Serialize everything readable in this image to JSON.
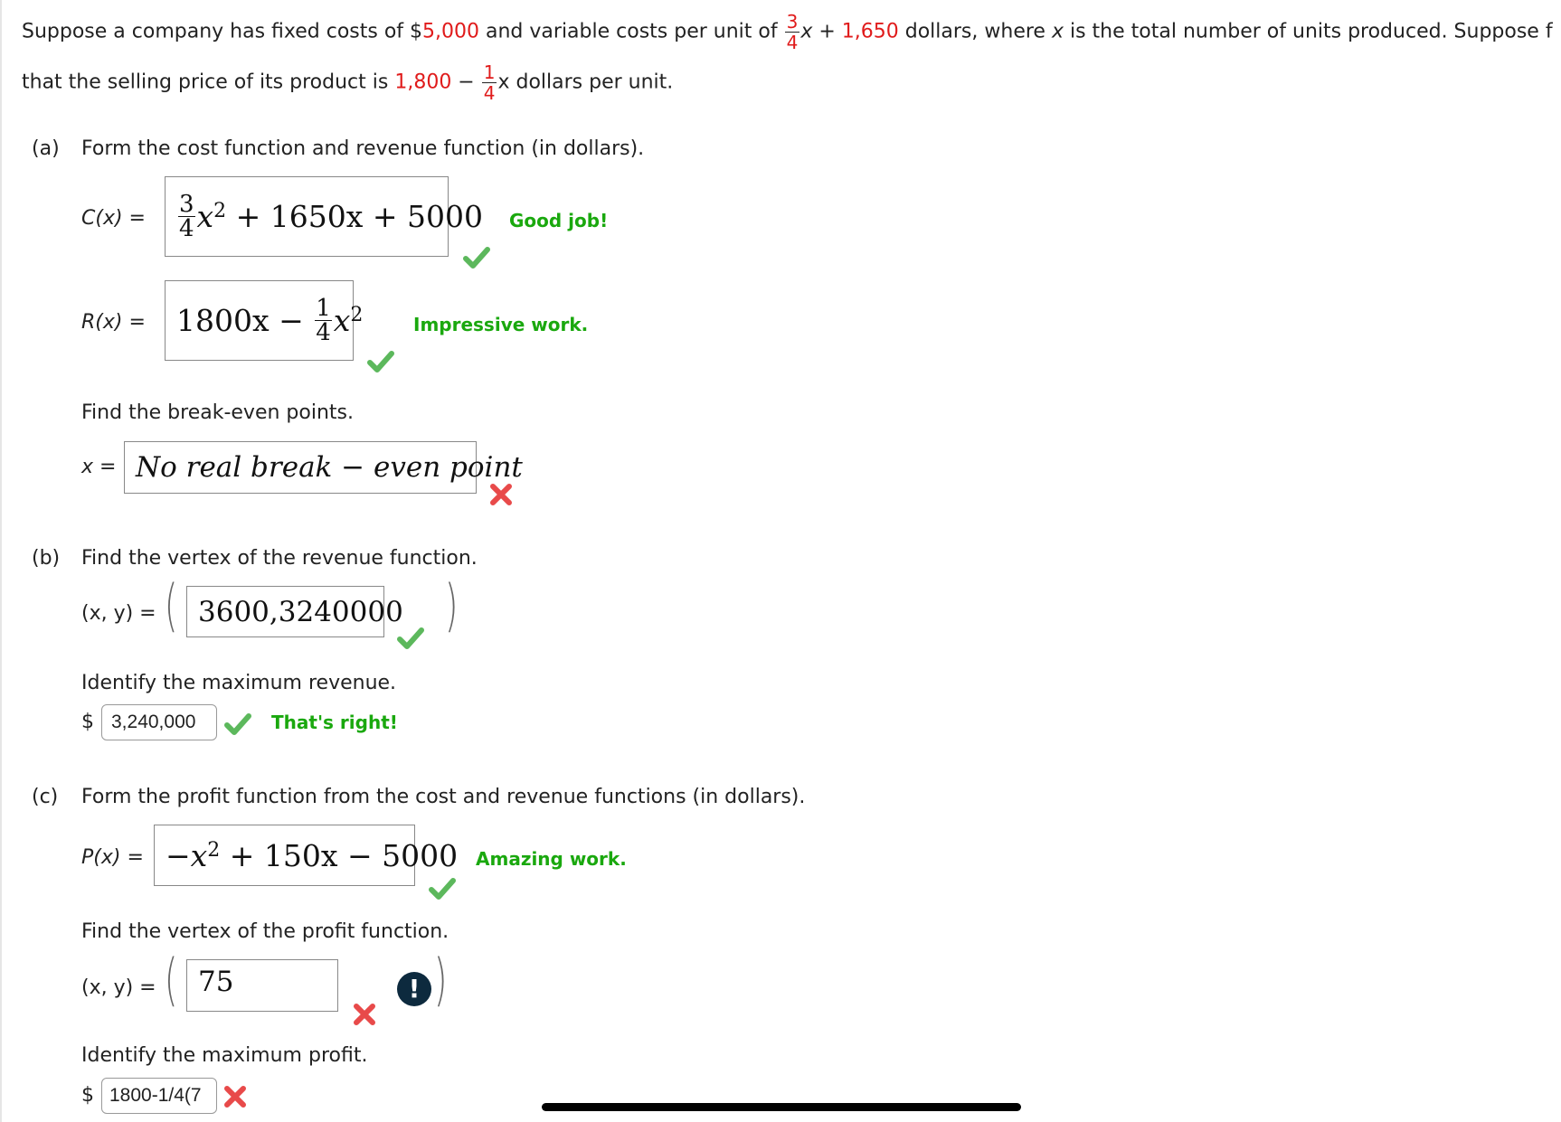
{
  "problem": {
    "line1_a": "Suppose a company has fixed costs of $",
    "fixed_cost": "5,000",
    "line1_b": " and variable costs per unit of ",
    "var_frac_num": "3",
    "var_frac_den": "4",
    "line1_c": "x + ",
    "var_const": "1,650",
    "line1_d": " dollars, where ",
    "line1_x": "x",
    "line1_e": " is the total number of units produced. Suppose f",
    "line2_a": "that the selling price of its product is ",
    "price_const": "1,800",
    "line2_minus": " − ",
    "price_frac_num": "1",
    "price_frac_den": "4",
    "line2_b": "x dollars per unit."
  },
  "part_a": {
    "label": "(a)",
    "prompt": "Form the cost function and revenue function (in dollars).",
    "cost_label": "C(x)  =",
    "cost_answer": {
      "frac_num": "3",
      "frac_den": "4",
      "rest": "+ 1650x + 5000"
    },
    "cost_feedback": "Good job!",
    "revenue_label": "R(x)  =",
    "revenue_answer": {
      "lead": "1800x −",
      "frac_num": "1",
      "frac_den": "4"
    },
    "revenue_feedback": "Impressive work.",
    "breakeven_prompt": "Find the break-even points.",
    "breakeven_label": "x =",
    "breakeven_answer": "No real break − even point"
  },
  "part_b": {
    "label": "(b)",
    "prompt": "Find the vertex of the revenue function.",
    "vertex_label": "(x, y) =",
    "vertex_answer": "3600,3240000",
    "max_prompt": "Identify the maximum revenue.",
    "currency": "$",
    "max_answer": "3,240,000",
    "max_feedback": "That's right!"
  },
  "part_c": {
    "label": "(c)",
    "prompt": "Form the profit function from the cost and revenue functions (in dollars).",
    "profit_label": "P(x) =",
    "profit_answer": {
      "lead": "−x",
      "rest": "+ 150x − 5000"
    },
    "profit_feedback": "Amazing work.",
    "vertex_prompt": "Find the vertex of the profit function.",
    "vertex_label": "(x, y) =",
    "vertex_answer": "75",
    "max_prompt": "Identify the maximum profit.",
    "currency": "$",
    "max_answer": "1800-1/4(7"
  },
  "icons": {
    "correct": "check-icon",
    "incorrect": "cross-icon",
    "alert": "exclamation-icon",
    "alert_glyph": "!"
  },
  "colors": {
    "correct_green": "#1aa80e",
    "incorrect_red": "#e84a4a",
    "param_red": "#e01b1b",
    "alert_navy": "#0d2a3e"
  }
}
